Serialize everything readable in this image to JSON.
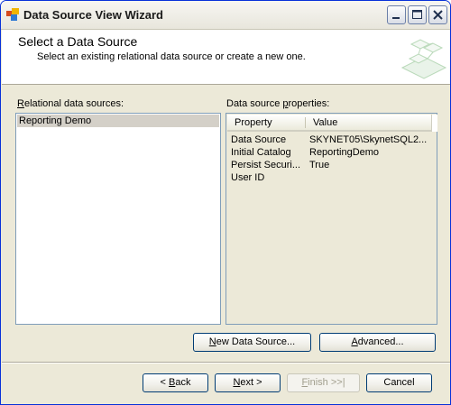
{
  "window": {
    "title": "Data Source View Wizard"
  },
  "header": {
    "title": "Select a Data Source",
    "subtitle": "Select an existing relational data source or create a new one."
  },
  "relational_sources": {
    "label_prefix": "",
    "label_accel": "R",
    "label_rest": "elational data sources:",
    "items": [
      "Reporting Demo"
    ]
  },
  "properties": {
    "label_prefix": "Data source ",
    "label_accel": "p",
    "label_rest": "roperties:",
    "columns": [
      "Property",
      "Value"
    ],
    "rows": [
      {
        "name": "Data Source",
        "value": "SKYNET05\\SkynetSQL2..."
      },
      {
        "name": "Initial Catalog",
        "value": "ReportingDemo"
      },
      {
        "name": "Persist Securi...",
        "value": "True"
      },
      {
        "name": "User ID",
        "value": ""
      }
    ]
  },
  "buttons": {
    "new_ds": {
      "accel": "N",
      "rest": "ew Data Source..."
    },
    "advanced": {
      "accel": "A",
      "rest": "dvanced..."
    },
    "back": {
      "prefix": "< ",
      "accel": "B",
      "rest": "ack"
    },
    "next": {
      "accel": "N",
      "rest": "ext >"
    },
    "finish": {
      "accel": "F",
      "rest": "inish >>|"
    },
    "cancel": {
      "label": "Cancel"
    }
  }
}
